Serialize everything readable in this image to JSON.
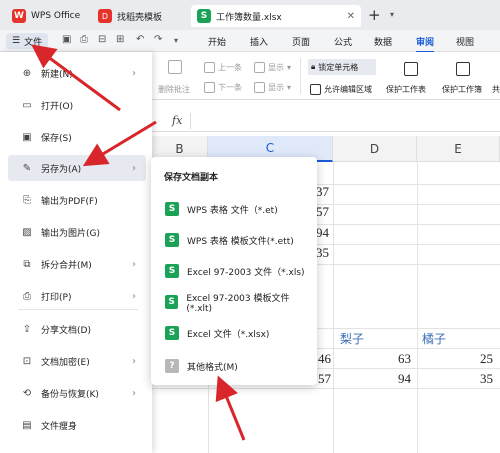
{
  "tabs": [
    {
      "label": "WPS Office",
      "logo": "W"
    },
    {
      "label": "找稻壳模板",
      "logo": "D"
    },
    {
      "label": "工作簿数量.xlsx",
      "logo": "S",
      "active": true
    }
  ],
  "menubar": {
    "file_label": "文件",
    "items": [
      "开始",
      "插入",
      "页面",
      "公式",
      "数据",
      "审阅",
      "视图"
    ],
    "active": "审阅"
  },
  "ribbon": {
    "delete_comment": "删除批注",
    "prev": "上一条",
    "next": "下一条",
    "show_all": "显示",
    "show_mode": "显示",
    "lock_cell": "锁定单元格",
    "allow_edit": "允许编辑区域",
    "protect_sheet": "保护工作表",
    "protect_book": "保护工作簿",
    "share": "共"
  },
  "formula_bar": {
    "fx": "fx"
  },
  "sheet": {
    "columns": [
      "B",
      "C",
      "D",
      "E"
    ],
    "selected_column": "C",
    "c_partial": [
      "37",
      "57",
      "94",
      "35"
    ],
    "headers": [
      "梨子",
      "橘子"
    ],
    "row1": [
      "46",
      "63",
      "25"
    ],
    "row2": [
      "57",
      "94",
      "35"
    ]
  },
  "file_menu": {
    "items": [
      {
        "label": "新建(N)",
        "icon": "new-file-icon",
        "arrow": true
      },
      {
        "label": "打开(O)",
        "icon": "folder-open-icon",
        "arrow": false
      },
      {
        "label": "保存(S)",
        "icon": "save-icon",
        "arrow": false
      },
      {
        "label": "另存为(A)",
        "icon": "save-as-icon",
        "arrow": true,
        "highlight": true
      },
      {
        "label": "输出为PDF(F)",
        "icon": "pdf-icon",
        "arrow": false
      },
      {
        "label": "输出为图片(G)",
        "icon": "image-icon",
        "arrow": false
      },
      {
        "label": "拆分合并(M)",
        "icon": "split-merge-icon",
        "arrow": true
      },
      {
        "label": "打印(P)",
        "icon": "print-icon",
        "arrow": true
      },
      {
        "label": "分享文档(D)",
        "icon": "share-icon",
        "arrow": false
      },
      {
        "label": "文档加密(E)",
        "icon": "encrypt-icon",
        "arrow": true
      },
      {
        "label": "备份与恢复(K)",
        "icon": "backup-icon",
        "arrow": true
      },
      {
        "label": "文件瘦身",
        "icon": "slim-icon",
        "arrow": false
      }
    ]
  },
  "submenu": {
    "title": "保存文档副本",
    "items": [
      {
        "label": "WPS 表格 文件（*.et)"
      },
      {
        "label": "WPS 表格 模板文件(*.ett)"
      },
      {
        "label": "Excel 97-2003 文件（*.xls)"
      },
      {
        "label": "Excel 97-2003 模板文件(*.xlt)"
      },
      {
        "label": "Excel 文件（*.xlsx)"
      },
      {
        "label": "其他格式(M)"
      }
    ]
  },
  "colors": {
    "accent": "#1a5cd8",
    "wps_red": "#e7322a",
    "et_green": "#1aa256",
    "arrow_red": "#d8262a"
  }
}
